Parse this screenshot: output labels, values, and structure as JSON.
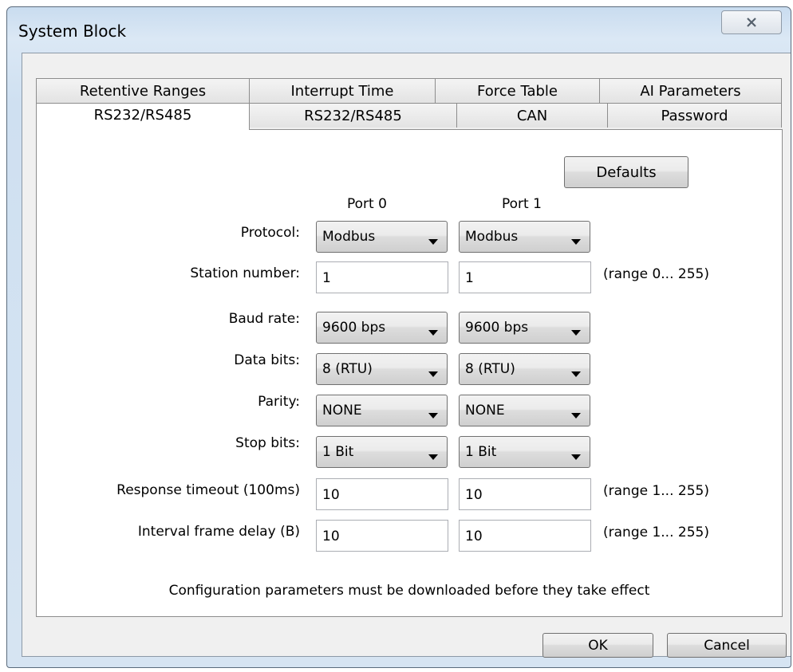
{
  "window": {
    "title": "System Block"
  },
  "tabs": {
    "back_row": [
      "Retentive Ranges",
      "Interrupt Time",
      "Force Table",
      "AI Parameters"
    ],
    "front_row": [
      "RS232/RS485",
      "RS232/RS485",
      "CAN",
      "Password"
    ],
    "active": "RS232/RS485"
  },
  "panel": {
    "defaults_label": "Defaults",
    "port0_header": "Port 0",
    "port1_header": "Port 1",
    "rows": {
      "protocol": {
        "label": "Protocol:",
        "port0": "Modbus",
        "port1": "Modbus"
      },
      "station": {
        "label": "Station number:",
        "port0": "1",
        "port1": "1",
        "range": "(range 0... 255)"
      },
      "baud": {
        "label": "Baud rate:",
        "port0": "9600 bps",
        "port1": "9600 bps"
      },
      "databits": {
        "label": "Data bits:",
        "port0": "8 (RTU)",
        "port1": "8 (RTU)"
      },
      "parity": {
        "label": "Parity:",
        "port0": "NONE",
        "port1": "NONE"
      },
      "stopbits": {
        "label": "Stop bits:",
        "port0": "1 Bit",
        "port1": "1 Bit"
      },
      "timeout": {
        "label": "Response timeout (100ms)",
        "port0": "10",
        "port1": "10",
        "range": "(range 1... 255)"
      },
      "interval": {
        "label": "Interval frame delay (B)",
        "port0": "10",
        "port1": "10",
        "range": "(range 1... 255)"
      }
    },
    "note": "Configuration parameters must be downloaded before they take effect"
  },
  "buttons": {
    "ok": "OK",
    "cancel": "Cancel"
  },
  "icons": {
    "close": "close-icon",
    "dropdown": "chevron-down-icon"
  }
}
